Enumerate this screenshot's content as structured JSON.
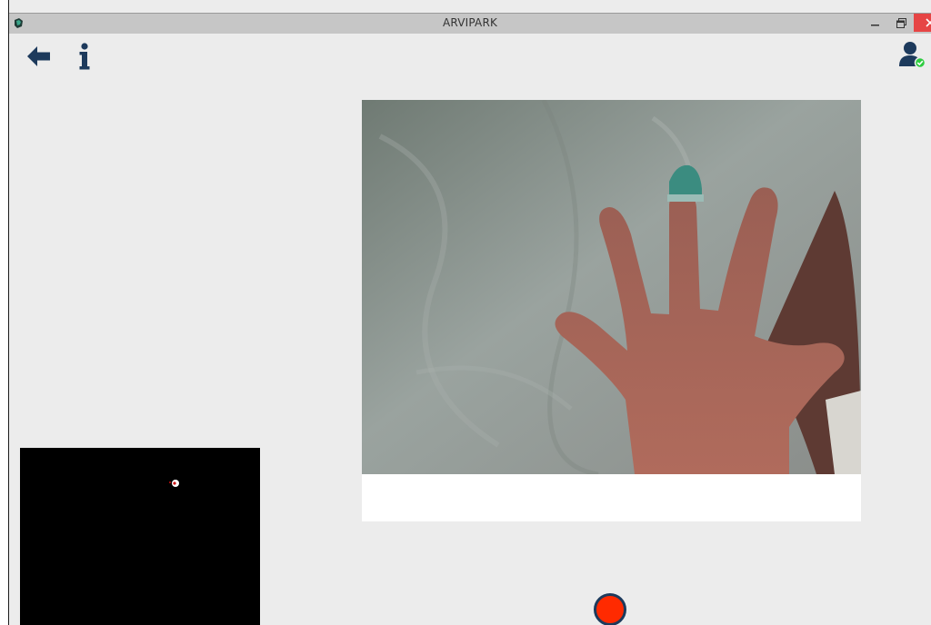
{
  "window": {
    "title": "ARVIPARK",
    "controls": [
      "minimize",
      "maximize",
      "close"
    ]
  },
  "toolbar": {
    "back_icon": "arrow-left-icon",
    "info_icon": "info-icon",
    "user_icon": "user-verified-icon"
  },
  "colors": {
    "background": "#ececec",
    "icon": "#1d3a5c",
    "verified_badge": "#2ecc40",
    "close_button": "#e64545",
    "record": "#ff2a00",
    "record_ring": "#1d3a5c"
  },
  "camera": {
    "feed": "camera-feed",
    "mask_preview": "mask-preview"
  },
  "record": {
    "icon": "record-icon"
  }
}
